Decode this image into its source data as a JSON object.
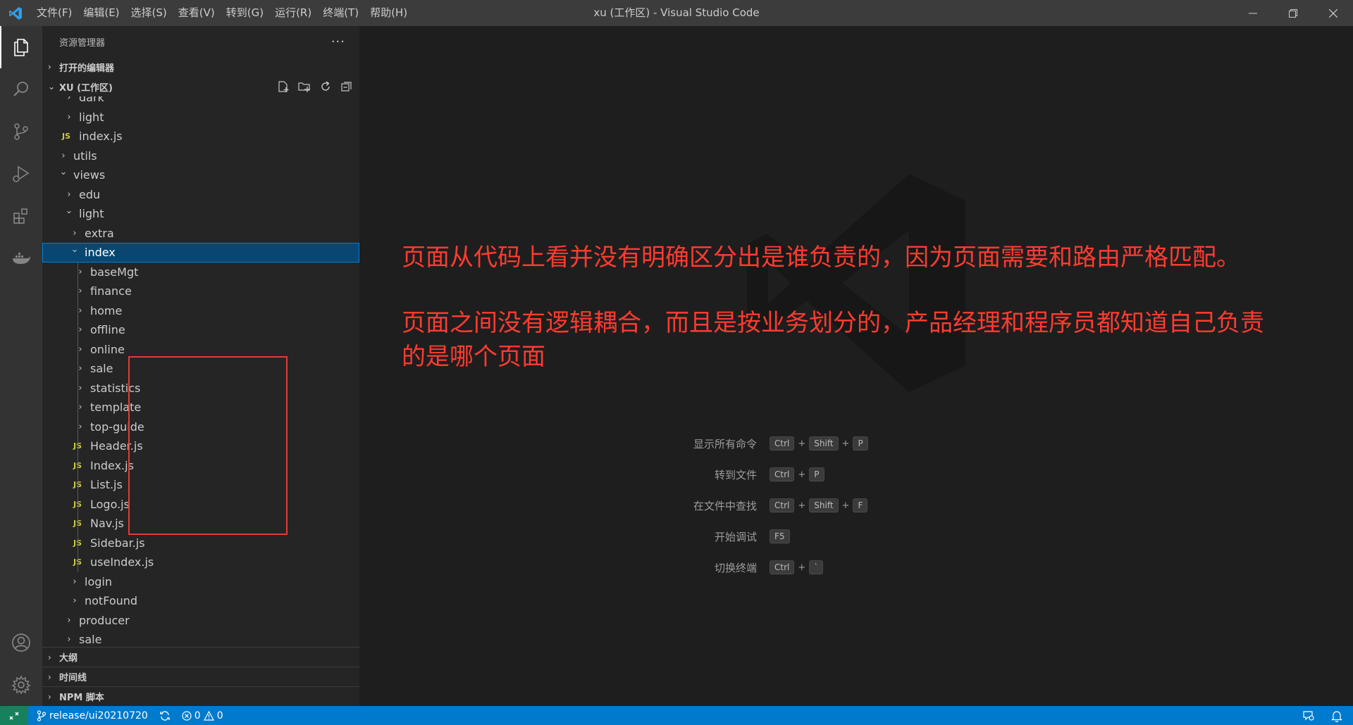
{
  "titlebar": {
    "menu": [
      "文件(F)",
      "编辑(E)",
      "选择(S)",
      "查看(V)",
      "转到(G)",
      "运行(R)",
      "终端(T)",
      "帮助(H)"
    ],
    "title": "xu (工作区) - Visual Studio Code"
  },
  "sidebar": {
    "title": "资源管理器",
    "more": "···",
    "open_editors": "打开的编辑器",
    "workspace": "XU (工作区)",
    "outline": "大纲",
    "timeline": "时间线",
    "npm": "NPM 脚本"
  },
  "tree": [
    {
      "label": "dark",
      "type": "folder",
      "depth": 2,
      "expanded": false
    },
    {
      "label": "light",
      "type": "folder",
      "depth": 2,
      "expanded": false
    },
    {
      "label": "index.js",
      "type": "js",
      "depth": 2
    },
    {
      "label": "utils",
      "type": "folder",
      "depth": 1,
      "expanded": false
    },
    {
      "label": "views",
      "type": "folder",
      "depth": 1,
      "expanded": true
    },
    {
      "label": "edu",
      "type": "folder",
      "depth": 2,
      "expanded": false
    },
    {
      "label": "light",
      "type": "folder",
      "depth": 2,
      "expanded": true
    },
    {
      "label": "extra",
      "type": "folder",
      "depth": 3,
      "expanded": false
    },
    {
      "label": "index",
      "type": "folder",
      "depth": 3,
      "expanded": true,
      "selected": true
    },
    {
      "label": "baseMgt",
      "type": "folder",
      "depth": 4,
      "expanded": false
    },
    {
      "label": "finance",
      "type": "folder",
      "depth": 4,
      "expanded": false
    },
    {
      "label": "home",
      "type": "folder",
      "depth": 4,
      "expanded": false
    },
    {
      "label": "offline",
      "type": "folder",
      "depth": 4,
      "expanded": false
    },
    {
      "label": "online",
      "type": "folder",
      "depth": 4,
      "expanded": false
    },
    {
      "label": "sale",
      "type": "folder",
      "depth": 4,
      "expanded": false
    },
    {
      "label": "statistics",
      "type": "folder",
      "depth": 4,
      "expanded": false
    },
    {
      "label": "template",
      "type": "folder",
      "depth": 4,
      "expanded": false
    },
    {
      "label": "top-guide",
      "type": "folder",
      "depth": 4,
      "expanded": false
    },
    {
      "label": "Header.js",
      "type": "js",
      "depth": 4
    },
    {
      "label": "Index.js",
      "type": "js",
      "depth": 4
    },
    {
      "label": "List.js",
      "type": "js",
      "depth": 4
    },
    {
      "label": "Logo.js",
      "type": "js",
      "depth": 4
    },
    {
      "label": "Nav.js",
      "type": "js",
      "depth": 4
    },
    {
      "label": "Sidebar.js",
      "type": "js",
      "depth": 4
    },
    {
      "label": "useIndex.js",
      "type": "js",
      "depth": 4
    },
    {
      "label": "login",
      "type": "folder",
      "depth": 3,
      "expanded": false
    },
    {
      "label": "notFound",
      "type": "folder",
      "depth": 3,
      "expanded": false
    },
    {
      "label": "producer",
      "type": "folder",
      "depth": 2,
      "expanded": false
    },
    {
      "label": "sale",
      "type": "folder",
      "depth": 2,
      "expanded": false
    }
  ],
  "js_badge": "JS",
  "annotation": {
    "line1": "页面从代码上看并没有明确区分出是谁负责的，因为页面需要和路由严格匹配。",
    "line2": "页面之间没有逻辑耦合，而且是按业务划分的，产品经理和程序员都知道自己负责",
    "line3": "的是哪个页面"
  },
  "shortcuts": [
    {
      "label": "显示所有命令",
      "keys": [
        "Ctrl",
        "Shift",
        "P"
      ]
    },
    {
      "label": "转到文件",
      "keys": [
        "Ctrl",
        "P"
      ]
    },
    {
      "label": "在文件中查找",
      "keys": [
        "Ctrl",
        "Shift",
        "F"
      ]
    },
    {
      "label": "开始调试",
      "keys": [
        "F5"
      ]
    },
    {
      "label": "切换终端",
      "keys": [
        "Ctrl",
        "`"
      ]
    }
  ],
  "statusbar": {
    "branch": "release/ui20210720",
    "errors": "0",
    "warnings": "0"
  },
  "colors": {
    "accent": "#007acc",
    "annotation": "#ff3b30",
    "selection": "#094771"
  }
}
